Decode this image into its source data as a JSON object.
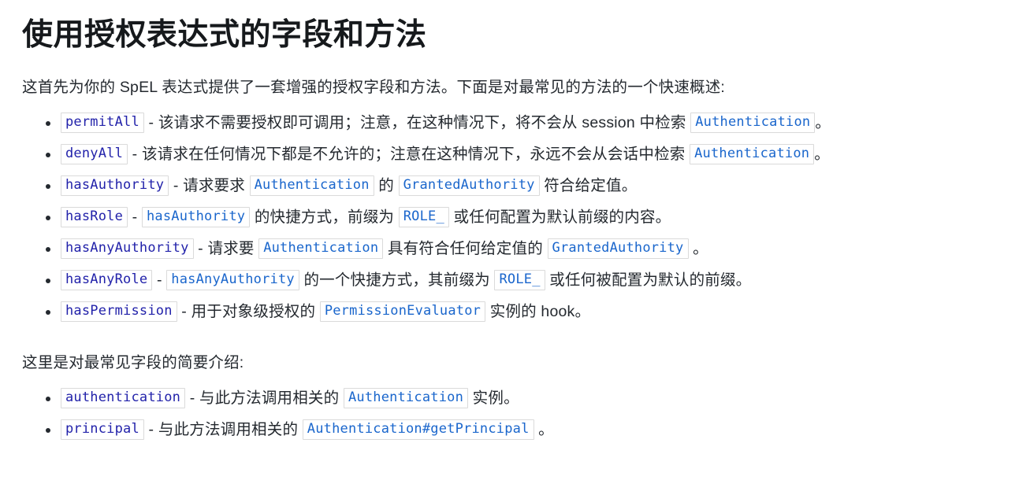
{
  "page": {
    "title": "使用授权表达式的字段和方法",
    "intro_paragraph": "这首先为你的 SpEL 表达式提供了一套增强的授权字段和方法。下面是对最常见的方法的一个快速概述:",
    "fields_paragraph": "这里是对最常见字段的简要介绍:"
  },
  "colors": {
    "keyword_code": "#2222aa",
    "type_code": "#1a66cc",
    "code_border": "#dadada",
    "body_text": "#24292f",
    "title_text": "#16191c",
    "background": "#ffffff"
  },
  "methods_list": [
    {
      "code": "permitAll",
      "seg1": " - 该请求不需要授权即可调用；注意，在这种情况下，将不会从 session 中检索 ",
      "code2": "Authentication",
      "seg2": "。"
    },
    {
      "code": "denyAll",
      "seg1": " - 该请求在任何情况下都是不允许的；注意在这种情况下，永远不会从会话中检索 ",
      "code2": "Authentication",
      "seg2": "。"
    },
    {
      "code": "hasAuthority",
      "seg1": " - 请求要求 ",
      "code2": "Authentication",
      "seg2": " 的 ",
      "code3": "GrantedAuthority",
      "seg3": " 符合给定值。"
    },
    {
      "code": "hasRole",
      "seg1": " - ",
      "code2": "hasAuthority",
      "seg2": " 的快捷方式，前缀为 ",
      "code3": "ROLE_",
      "seg3": " 或任何配置为默认前缀的内容。"
    },
    {
      "code": "hasAnyAuthority",
      "seg1": " - 请求要 ",
      "code2": "Authentication",
      "seg2": " 具有符合任何给定值的 ",
      "code3": "GrantedAuthority",
      "seg3": " 。"
    },
    {
      "code": "hasAnyRole",
      "seg1": " - ",
      "code2": "hasAnyAuthority",
      "seg2": " 的一个快捷方式，其前缀为 ",
      "code3": "ROLE_",
      "seg3": " 或任何被配置为默认的前缀。"
    },
    {
      "code": "hasPermission",
      "seg1": " - 用于对象级授权的 ",
      "code2": "PermissionEvaluator",
      "seg2": " 实例的 hook。"
    }
  ],
  "fields_list": [
    {
      "code": "authentication",
      "seg1": " - 与此方法调用相关的 ",
      "code2": "Authentication",
      "seg2": " 实例。"
    },
    {
      "code": "principal",
      "seg1": " - 与此方法调用相关的 ",
      "code2": "Authentication#getPrincipal",
      "seg2": " 。"
    }
  ]
}
